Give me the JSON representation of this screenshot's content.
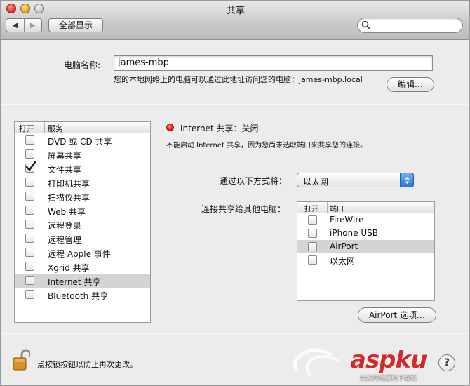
{
  "window": {
    "title": "共享"
  },
  "toolbar": {
    "back": "◀",
    "forward": "▶",
    "show_all": "全部显示",
    "search_placeholder": ""
  },
  "computer": {
    "label": "电脑名称:",
    "name": "james-mbp",
    "address_text": "您的本地网络上的电脑可以通过此地址访问您的电脑：james-mbp.local",
    "edit_button": "编辑…"
  },
  "services": {
    "col_on": "打开",
    "col_service": "服务",
    "items": [
      {
        "label": "DVD 或 CD 共享",
        "checked": false
      },
      {
        "label": "屏幕共享",
        "checked": false
      },
      {
        "label": "文件共享",
        "checked": true
      },
      {
        "label": "打印机共享",
        "checked": false
      },
      {
        "label": "扫描仪共享",
        "checked": false
      },
      {
        "label": "Web 共享",
        "checked": false
      },
      {
        "label": "远程登录",
        "checked": false
      },
      {
        "label": "远程管理",
        "checked": false
      },
      {
        "label": "远程 Apple 事件",
        "checked": false
      },
      {
        "label": "Xgrid 共享",
        "checked": false
      },
      {
        "label": "Internet 共享",
        "checked": false,
        "selected": true
      },
      {
        "label": "Bluetooth 共享",
        "checked": false
      }
    ]
  },
  "detail": {
    "status": "Internet 共享：关闭",
    "status_color": "#d9271a",
    "description": "不能启动 Internet 共享，因为您尚未选取端口来共享您的连接。",
    "via_label": "通过以下方式将：",
    "via_value": "以太网",
    "share_label": "连接共享给其他电脑：",
    "ports_col_on": "打开",
    "ports_col_port": "端口",
    "ports": [
      {
        "label": "FireWire",
        "checked": false
      },
      {
        "label": "iPhone USB",
        "checked": false
      },
      {
        "label": "AirPort",
        "checked": false,
        "selected": true
      },
      {
        "label": "以太网",
        "checked": false
      }
    ],
    "airport_button": "AirPort 选项…"
  },
  "footer": {
    "lock_text": "点按锁按钮以防止再次更改。",
    "help": "?"
  },
  "watermark": {
    "main": "aspku",
    "sub": "免费网站源码下载站"
  }
}
